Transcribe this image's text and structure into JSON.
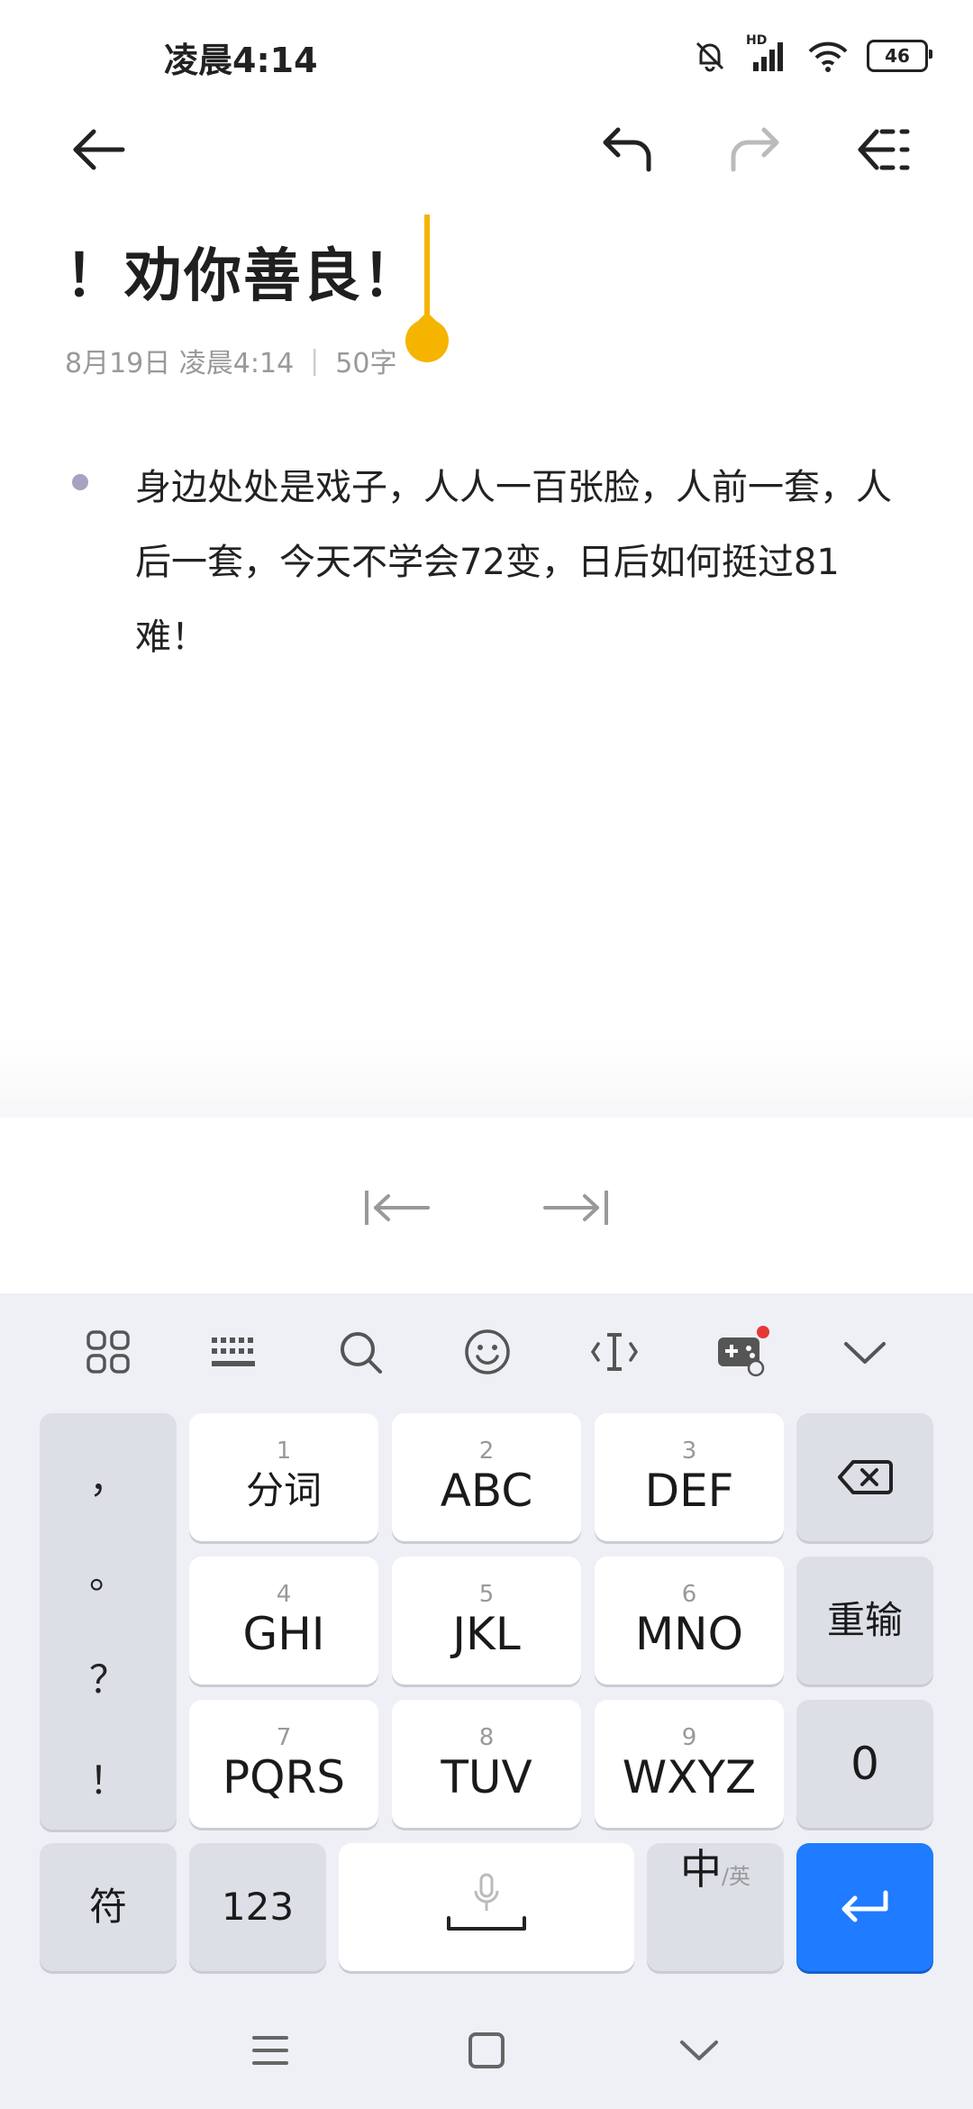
{
  "status": {
    "time": "凌晨4:14",
    "battery": "46",
    "network": "HD"
  },
  "note": {
    "title": "！劝你善良！",
    "date": "8月19日 凌晨4:14",
    "separator": "|",
    "word_count": "50字",
    "body": "身边处处是戏子，人人一百张脸，人前一套，人后一套，今天不学会72变，日后如何挺过81难！"
  },
  "keyboard": {
    "punctuation": [
      "，",
      "。",
      "？",
      "！"
    ],
    "keys": [
      {
        "num": "1",
        "label": "分词"
      },
      {
        "num": "2",
        "label": "ABC"
      },
      {
        "num": "3",
        "label": "DEF"
      },
      {
        "num": "4",
        "label": "GHI"
      },
      {
        "num": "5",
        "label": "JKL"
      },
      {
        "num": "6",
        "label": "MNO"
      },
      {
        "num": "7",
        "label": "PQRS"
      },
      {
        "num": "8",
        "label": "TUV"
      },
      {
        "num": "9",
        "label": "WXYZ"
      }
    ],
    "reenter": "重输",
    "zero": "0",
    "symbols": "符",
    "numbers": "123",
    "lang_main": "中",
    "lang_alt": "/英"
  },
  "colors": {
    "accent": "#1f7bff",
    "cursor": "#f5b400",
    "bullet": "#a5a3c0"
  }
}
